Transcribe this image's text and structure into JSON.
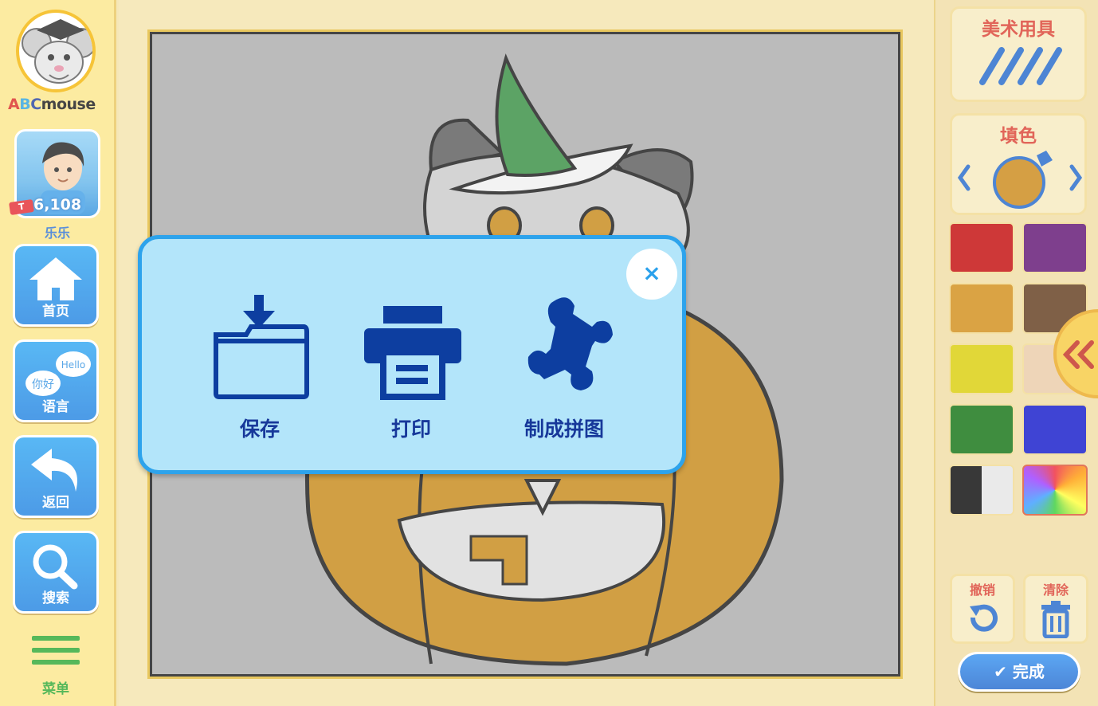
{
  "app": {
    "logo_text_a": "A",
    "logo_text_b": "B",
    "logo_text_c": "C",
    "logo_text_rest": "mouse"
  },
  "sidebar": {
    "points": "6,108",
    "ticket_label": "T",
    "username": "乐乐",
    "home_label": "首页",
    "language_label": "语言",
    "language_bubble_en": "Hello",
    "language_bubble_zh": "你好",
    "back_label": "返回",
    "search_label": "搜索",
    "menu_label": "菜单"
  },
  "tools_panel": {
    "art_tools_title": "美术用具",
    "fill_title": "填色",
    "selected_color": "#c98410",
    "swatches": [
      "#c00000",
      "#5a0a6e",
      "#d08a10",
      "#5c3414",
      "#d9cc00",
      "#e9c9a4",
      "#0a6e0a",
      "#0a10c8",
      "#000000",
      "#rainbow"
    ],
    "undo_label": "撤销",
    "clear_label": "清除",
    "done_label": "完成"
  },
  "dialog": {
    "close_label": "×",
    "save_label": "保存",
    "print_label": "打印",
    "puzzle_label": "制成拼图"
  }
}
